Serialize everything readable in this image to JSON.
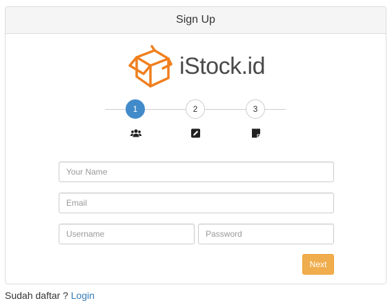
{
  "panel": {
    "title": "Sign Up"
  },
  "logo": {
    "text": "iStock.id",
    "color": "#f07f1e"
  },
  "wizard": {
    "steps": [
      {
        "number": "1",
        "active": true,
        "icon": "users-icon"
      },
      {
        "number": "2",
        "active": false,
        "icon": "edit-icon"
      },
      {
        "number": "3",
        "active": false,
        "icon": "note-icon"
      }
    ],
    "active_color": "#428bca"
  },
  "form": {
    "name_placeholder": "Your Name",
    "email_placeholder": "Email",
    "username_placeholder": "Username",
    "password_placeholder": "Password",
    "next_label": "Next",
    "next_color": "#f0ad4e"
  },
  "footer": {
    "prompt": "Sudah daftar ? ",
    "login_label": "Login",
    "link_color": "#337ab7"
  }
}
